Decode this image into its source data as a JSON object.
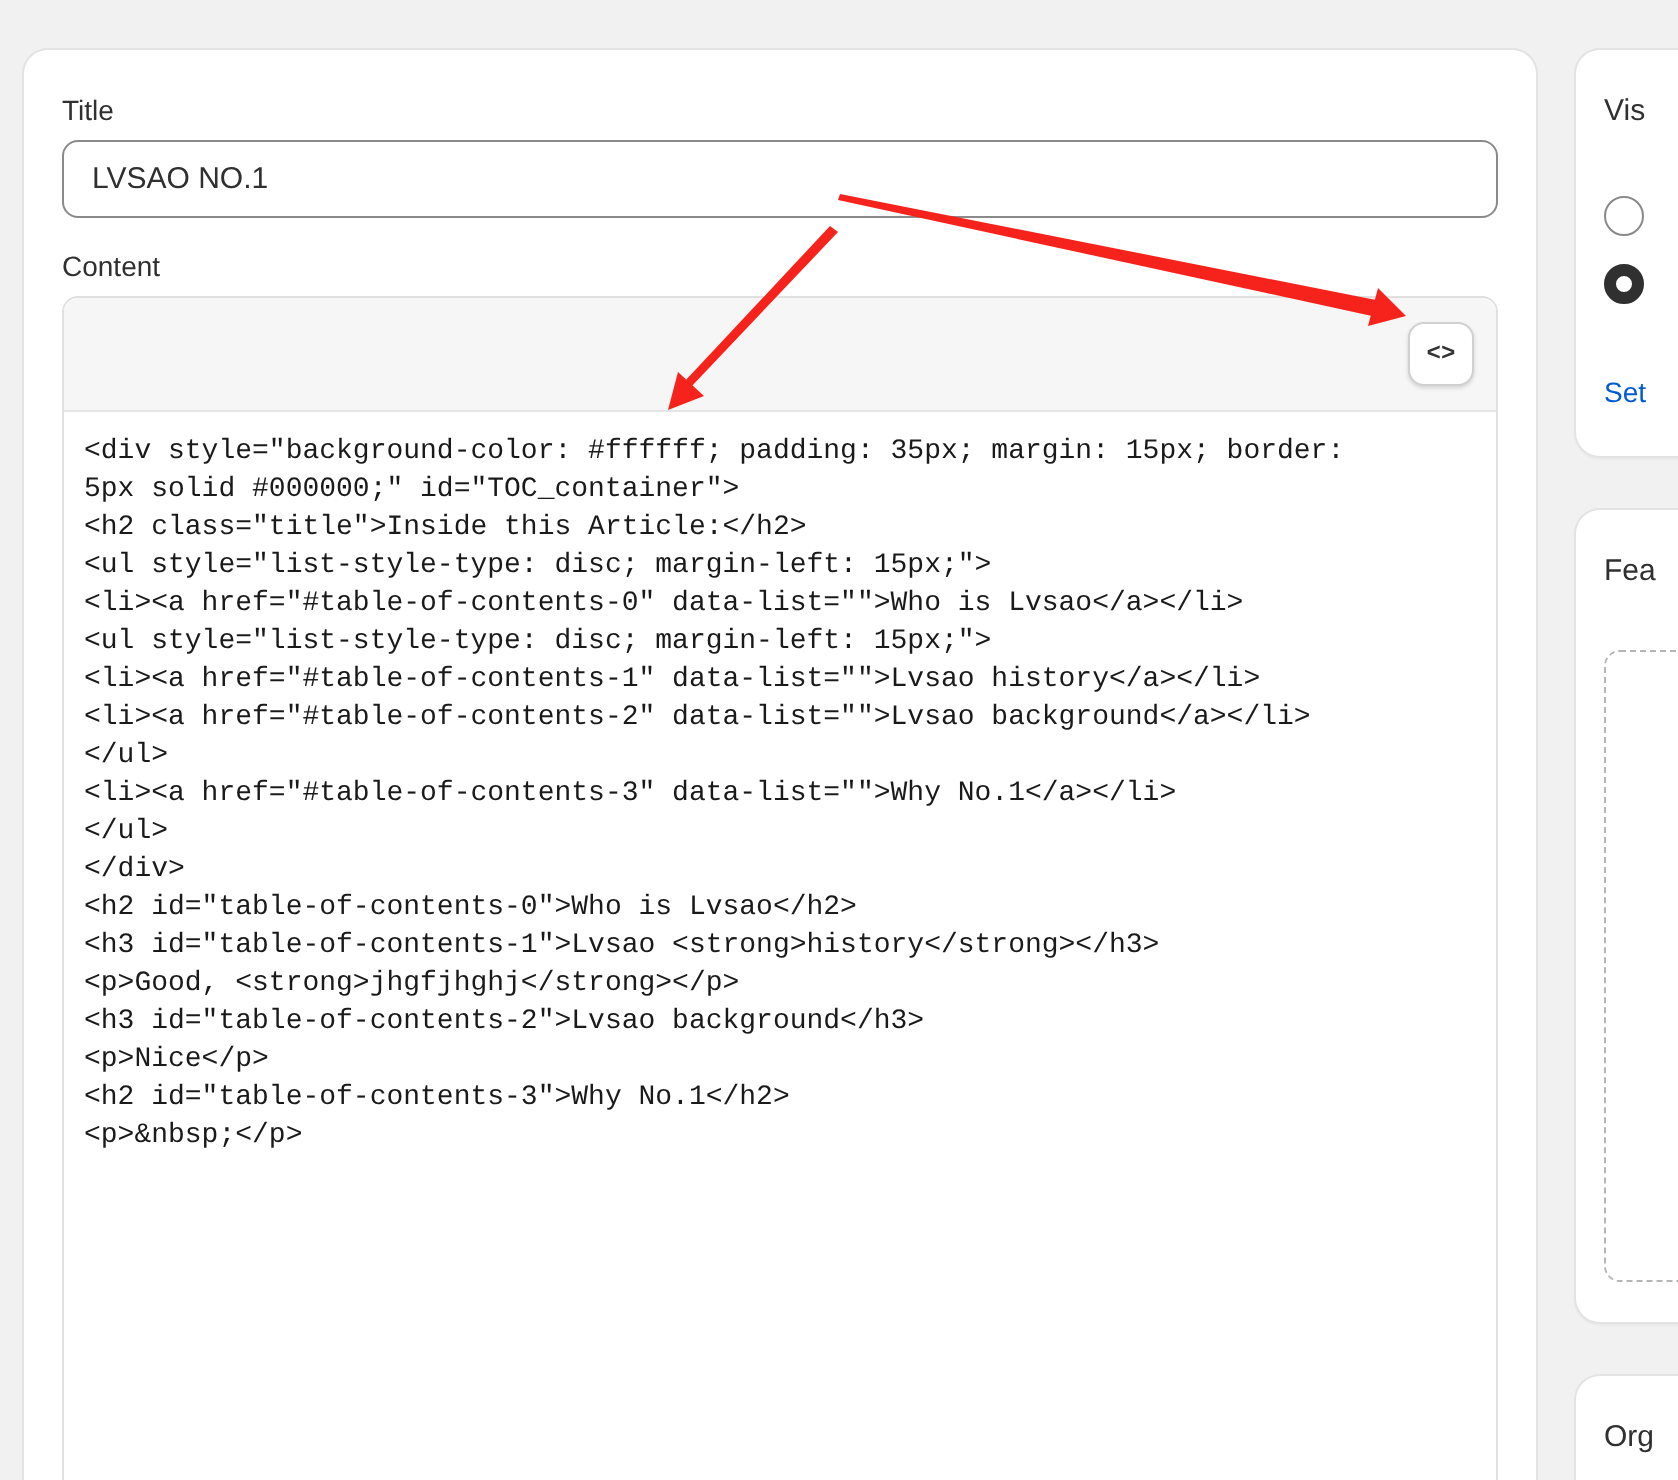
{
  "title_field": {
    "label": "Title",
    "value": "LVSAO NO.1"
  },
  "content": {
    "label": "Content",
    "toggle_button": "<>",
    "code_lines": [
      "<div style=\"background-color: #ffffff; padding: 35px; margin: 15px; border: 5px solid #000000;\" id=\"TOC_container\">",
      "<h2 class=\"title\">Inside this Article:</h2>",
      "<ul style=\"list-style-type: disc; margin-left: 15px;\">",
      "<li><a href=\"#table-of-contents-0\" data-list=\"\">Who is Lvsao</a></li>",
      "<ul style=\"list-style-type: disc; margin-left: 15px;\">",
      "<li><a href=\"#table-of-contents-1\" data-list=\"\">Lvsao history</a></li>",
      "<li><a href=\"#table-of-contents-2\" data-list=\"\">Lvsao background</a></li>",
      "</ul>",
      "<li><a href=\"#table-of-contents-3\" data-list=\"\">Why No.1</a></li>",
      "</ul>",
      "</div>",
      "<h2 id=\"table-of-contents-0\">Who is Lvsao</h2>",
      "<h3 id=\"table-of-contents-1\">Lvsao <strong>history</strong></h3>",
      "<p>Good, <strong>jhgfjhghj</strong></p>",
      "<h3 id=\"table-of-contents-2\">Lvsao background</h3>",
      "<p>Nice</p>",
      "<h2 id=\"table-of-contents-3\">Why No.1</h2>",
      "<p>&nbsp;</p>"
    ]
  },
  "visibility": {
    "title": "Vis",
    "options": [
      {
        "selected": false
      },
      {
        "selected": true
      }
    ],
    "link": "Set"
  },
  "featured": {
    "title": "Fea"
  },
  "organization": {
    "title": "Org"
  }
}
